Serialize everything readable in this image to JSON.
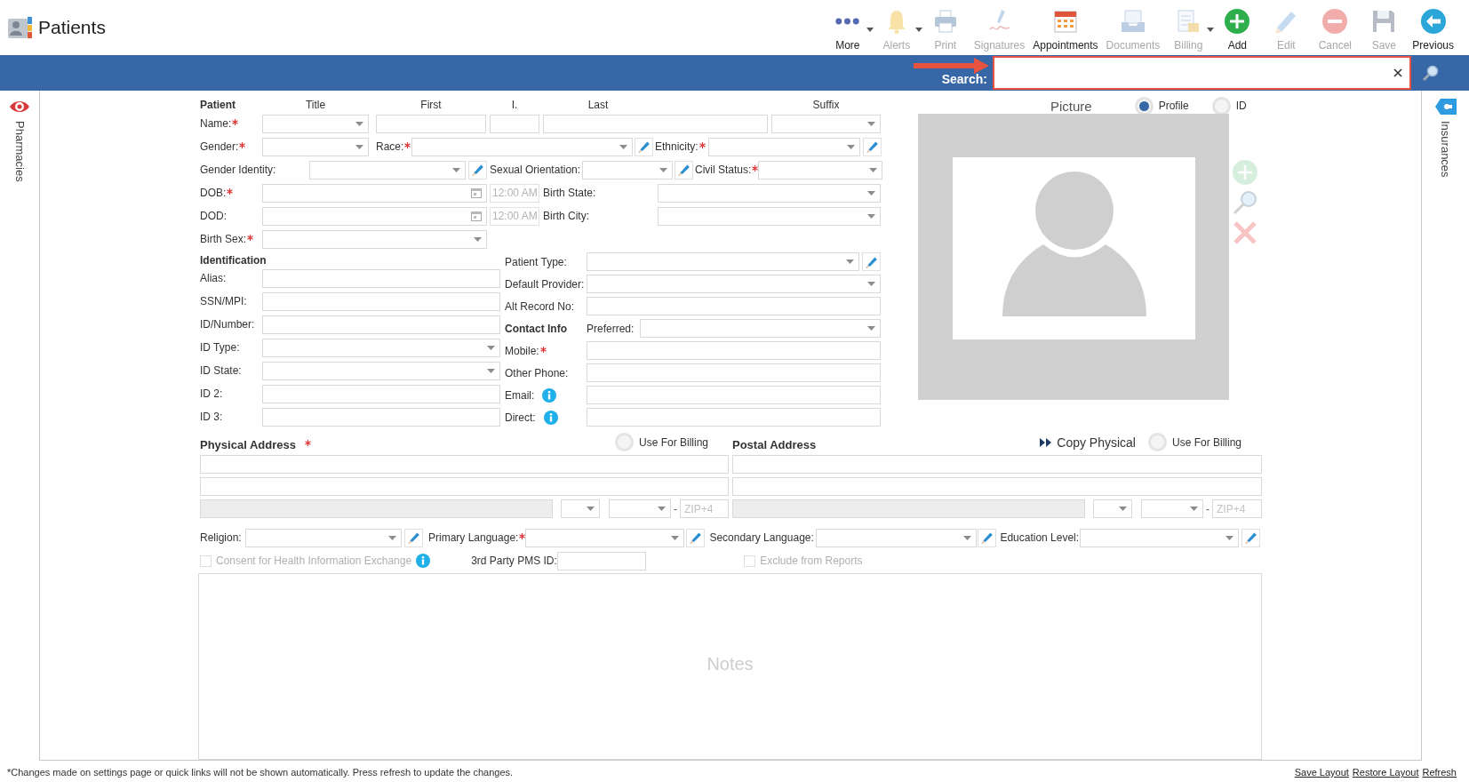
{
  "header": {
    "title": "Patients"
  },
  "toolbar": [
    {
      "label": "More",
      "kind": "dots",
      "disabled": false,
      "menu": true
    },
    {
      "label": "Alerts",
      "kind": "bell",
      "disabled": true,
      "menu": true
    },
    {
      "label": "Print",
      "kind": "printer",
      "disabled": true,
      "menu": false
    },
    {
      "label": "Signatures",
      "kind": "signature",
      "disabled": true,
      "menu": false
    },
    {
      "label": "Appointments",
      "kind": "calendar",
      "disabled": false,
      "menu": false
    },
    {
      "label": "Documents",
      "kind": "tray",
      "disabled": true,
      "menu": false
    },
    {
      "label": "Billing",
      "kind": "bill",
      "disabled": true,
      "menu": true
    },
    {
      "label": "Add",
      "kind": "add",
      "disabled": false,
      "menu": false
    },
    {
      "label": "Edit",
      "kind": "pencil",
      "disabled": true,
      "menu": false
    },
    {
      "label": "Cancel",
      "kind": "cancel",
      "disabled": true,
      "menu": false
    },
    {
      "label": "Save",
      "kind": "save",
      "disabled": true,
      "menu": false
    },
    {
      "label": "Previous",
      "kind": "back",
      "disabled": false,
      "menu": false
    }
  ],
  "search": {
    "label": "Search:",
    "highlight": true
  },
  "side_tabs": {
    "left": {
      "label": "Pharmacies"
    },
    "right": {
      "label": "Insurances"
    }
  },
  "patient": {
    "heading": "Patient",
    "column_heads": [
      "Title",
      "First",
      "I.",
      "Last",
      "Suffix"
    ],
    "rows": [
      {
        "items": [
          {
            "kind": "label",
            "text": "Name:",
            "required": true
          },
          {
            "kind": "select"
          },
          {
            "kind": "input"
          },
          {
            "kind": "input"
          },
          {
            "kind": "input"
          },
          {
            "kind": "select"
          }
        ]
      },
      {
        "items": [
          {
            "kind": "label",
            "text": "Gender:",
            "required": true
          },
          {
            "kind": "select"
          },
          {
            "kind": "label",
            "text": "Race:",
            "required": true
          },
          {
            "kind": "select"
          },
          {
            "kind": "pencil"
          },
          {
            "kind": "label",
            "text": "Ethnicity:",
            "required": true
          },
          {
            "kind": "select"
          },
          {
            "kind": "pencil"
          }
        ]
      },
      {
        "items": [
          {
            "kind": "label",
            "text": "Gender Identity:",
            "required": false
          },
          {
            "kind": "select"
          },
          {
            "kind": "pencil"
          },
          {
            "kind": "label",
            "text": "Sexual Orientation:",
            "required": false
          },
          {
            "kind": "select"
          },
          {
            "kind": "pencil"
          },
          {
            "kind": "label",
            "text": "Civil Status:",
            "required": true
          },
          {
            "kind": "select"
          }
        ]
      },
      {
        "items": [
          {
            "kind": "label",
            "text": "DOB:",
            "required": true
          },
          {
            "kind": "date"
          },
          {
            "kind": "time",
            "value": "12:00 AM",
            "disabled": true
          },
          {
            "kind": "label",
            "text": "Birth State:",
            "required": false
          },
          {
            "kind": "select"
          }
        ]
      },
      {
        "items": [
          {
            "kind": "label",
            "text": "DOD:",
            "required": false
          },
          {
            "kind": "date"
          },
          {
            "kind": "time",
            "value": "12:00 AM",
            "disabled": true
          },
          {
            "kind": "label",
            "text": "Birth City:",
            "required": false
          },
          {
            "kind": "select"
          }
        ]
      },
      {
        "items": [
          {
            "kind": "label",
            "text": "Birth Sex:",
            "required": true
          },
          {
            "kind": "select"
          }
        ]
      }
    ]
  },
  "identification": {
    "heading": "Identification",
    "fields": [
      {
        "label": "Alias:",
        "kind": "input"
      },
      {
        "label": "SSN/MPI:",
        "kind": "input"
      },
      {
        "label": "ID/Number:",
        "kind": "input"
      },
      {
        "label": "ID Type:",
        "kind": "select"
      },
      {
        "label": "ID State:",
        "kind": "select"
      },
      {
        "label": "ID 2:",
        "kind": "input"
      },
      {
        "label": "ID 3:",
        "kind": "input"
      }
    ]
  },
  "details": {
    "fields": [
      {
        "label": "Patient Type:",
        "kind": "select-edit"
      },
      {
        "label": "Default Provider:",
        "kind": "select"
      },
      {
        "label": "Alt Record No:",
        "kind": "input"
      },
      {
        "kind": "contact",
        "heading": "Contact Info",
        "label": "Preferred:"
      },
      {
        "label": "Mobile:",
        "kind": "input",
        "required": true
      },
      {
        "label": "Other Phone:",
        "kind": "input"
      },
      {
        "label": "Email:",
        "kind": "input",
        "info": true
      },
      {
        "label": "Direct:",
        "kind": "input",
        "info": true
      }
    ]
  },
  "picture": {
    "title": "Picture",
    "options": [
      {
        "label": "Profile",
        "selected": true
      },
      {
        "label": "ID",
        "selected": false
      }
    ]
  },
  "physical_address": {
    "title": "Physical Address",
    "required": true,
    "billing_option": {
      "label": "Use For Billing",
      "selected": false
    },
    "zip_dash": "-",
    "zip4_placeholder": "ZIP+4"
  },
  "postal_address": {
    "title": "Postal Address",
    "copy_button": "Copy Physical",
    "billing_option": {
      "label": "Use For Billing",
      "selected": false
    },
    "zip_dash": "-",
    "zip4_placeholder": "ZIP+4"
  },
  "demographics": [
    {
      "label": "Religion:",
      "required": false
    },
    {
      "label": "Primary Language:",
      "required": true
    },
    {
      "label": "Secondary Language:",
      "required": false
    },
    {
      "label": "Education Level:",
      "required": false
    }
  ],
  "consent": {
    "label": "Consent for Health Information Exchange",
    "checked": false,
    "disabled": true,
    "info": true
  },
  "pms_id": {
    "label": "3rd Party PMS ID:"
  },
  "exclude_reports": {
    "label": "Exclude from Reports",
    "checked": false,
    "disabled": true
  },
  "notes": {
    "placeholder": "Notes"
  },
  "footer": {
    "note": "*Changes made on settings page or quick links will not be shown automatically. Press refresh to update the changes.",
    "links": [
      "Save Layout",
      "Restore Layout",
      "Refresh"
    ]
  }
}
